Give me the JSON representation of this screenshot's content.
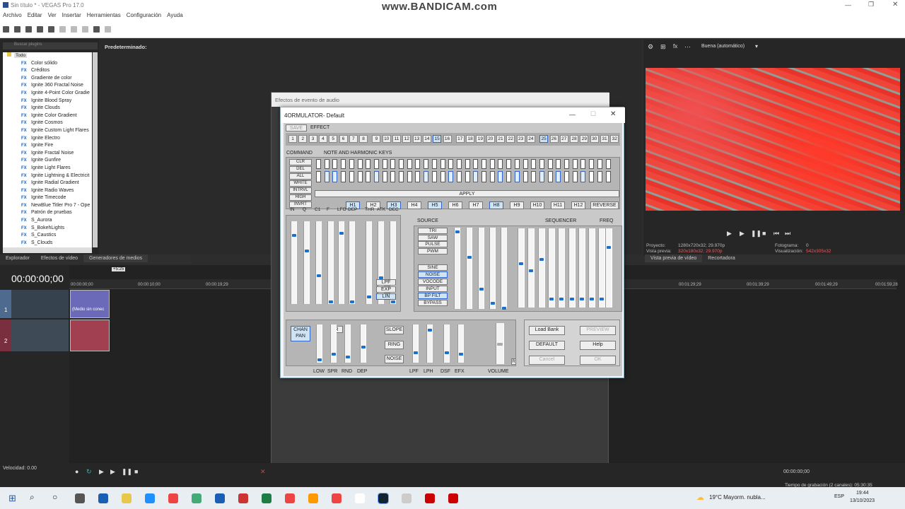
{
  "app": {
    "title": "Sin título * - VEGAS Pro 17.0",
    "watermark": "www.BANDICAM.com",
    "menu": [
      "Archivo",
      "Editar",
      "Ver",
      "Insertar",
      "Herramientas",
      "Configuración",
      "Ayuda"
    ]
  },
  "fx_browser": {
    "search_placeholder": "Buscar plugins",
    "root": "Todo",
    "items": [
      "Color sólido",
      "Créditos",
      "Gradiente de color",
      "Ignite 360 Fractal Noise",
      "Ignite 4-Point Color Gradie",
      "Ignite Blood Spray",
      "Ignite Clouds",
      "Ignite Color Gradient",
      "Ignite Cosmos",
      "Ignite Custom Light Flares",
      "Ignite Electro",
      "Ignite Fire",
      "Ignite Fractal Noise",
      "Ignite Gunfire",
      "Ignite Light Flares",
      "Ignite Lightning & Electricit",
      "Ignite Radial Gradient",
      "Ignite Radio Waves",
      "Ignite Timecode",
      "NewBlue Titler Pro 7 - Ope",
      "Patrón de pruebas",
      "S_Aurora",
      "S_BokehLights",
      "S_Caustics",
      "S_Clouds"
    ],
    "fx_tag": "FX",
    "presets_header": "Predeterminado:"
  },
  "preview": {
    "quality": "Buena (automático)",
    "proyecto_label": "Proyecto:",
    "proyecto_value": "1280x720x32; 29.970p",
    "vista_label": "Vista previa:",
    "vista_value": "320x180x32; 29.970p",
    "fotograma_label": "Fotograma:",
    "fotograma_value": "0",
    "visualizacion_label": "Visualización:",
    "visualizacion_value": "542x305x32",
    "tab1": "Vista previa de vídeo",
    "tab2": "Recortadora"
  },
  "bottom_tabs": [
    "Explorador",
    "Efectos de vídeo",
    "Generadores de medios"
  ],
  "timeline": {
    "timecode": "00:00:00;00",
    "ruler": [
      "00:00:00;00",
      "00:00:10;00",
      "00:00:19;29",
      "00:01:29;29",
      "00:01:39;29",
      "00:01:49;29",
      "00:01:59;28"
    ],
    "marker": "+5:25",
    "clip_label": "(Medio sin conec",
    "velocidad": "Velocidad: 0.00",
    "end_time": "00:00:00;00",
    "grabacion": "Tiempo de grabación (2 canales): 05:30:35",
    "track1": "1",
    "track2": "2"
  },
  "dialog_back": {
    "title": "Efectos de evento de audio"
  },
  "plugin": {
    "title": "4ORMULATOR- Default",
    "save": "SAVE",
    "effect": "EFFECT",
    "numbers": [
      "1",
      "2",
      "3",
      "4",
      "5",
      "6",
      "7",
      "8",
      "9",
      "10",
      "11",
      "12",
      "13",
      "14",
      "15",
      "16",
      "17",
      "18",
      "19",
      "20",
      "21",
      "22",
      "23",
      "24",
      "25",
      "26",
      "27",
      "28",
      "29",
      "30",
      "31",
      "32"
    ],
    "command_label": "COMMAND",
    "keys_label": "NOTE AND HARMONIC KEYS",
    "commands": [
      "CLR",
      "DEL",
      "ALL",
      "WHITE",
      "INTRVL",
      "HIGH",
      "INVRT"
    ],
    "apply": "APPLY",
    "harmonics": [
      "H1",
      "H2",
      "H3",
      "H4",
      "H5",
      "H6",
      "H7",
      "H8",
      "H9",
      "H10",
      "H11",
      "H12"
    ],
    "reverse": "REVERSE",
    "filter_labels": [
      "IN",
      "Q",
      "C1",
      "F",
      "LFO",
      "DEP",
      "THR",
      "ATK",
      "DEC"
    ],
    "filter_btns": [
      "LPF",
      "EXP",
      "LIN"
    ],
    "source_label": "SOURCE",
    "sources": [
      "TRI",
      "SAW",
      "PULSE",
      "PWM",
      "SINE",
      "NOISE",
      "VOCODE",
      "INPUT",
      "BP FILT",
      "BYPASS"
    ],
    "src_labels": [
      "Q",
      "C2",
      "F",
      "LFO",
      "DEP"
    ],
    "sequencer": "SEQUENCER",
    "freq": "FREQ",
    "chan": "CHAN",
    "pan": "PAN",
    "r": "R",
    "slope": "SLOPE",
    "ring": "RING",
    "noise": "NOISE",
    "bottom_labels": [
      "LOW",
      "SPR",
      "RND",
      "DEP",
      "LPF",
      "LPH",
      "DSF",
      "EFX",
      "VOLUME"
    ],
    "load_bank": "Load Bank",
    "preview_btn": "PREVIEW",
    "default_btn": "DEFAULT",
    "help": "Help",
    "cancel": "Cancel",
    "ok": "OK"
  },
  "taskbar": {
    "weather": "19°C  Mayorm. nubla...",
    "lang": "ESP",
    "time": "19:44",
    "date": "13/10/2023"
  },
  "colors": {
    "accent": "#1a6fd1",
    "preview_red": "#e8332a"
  }
}
